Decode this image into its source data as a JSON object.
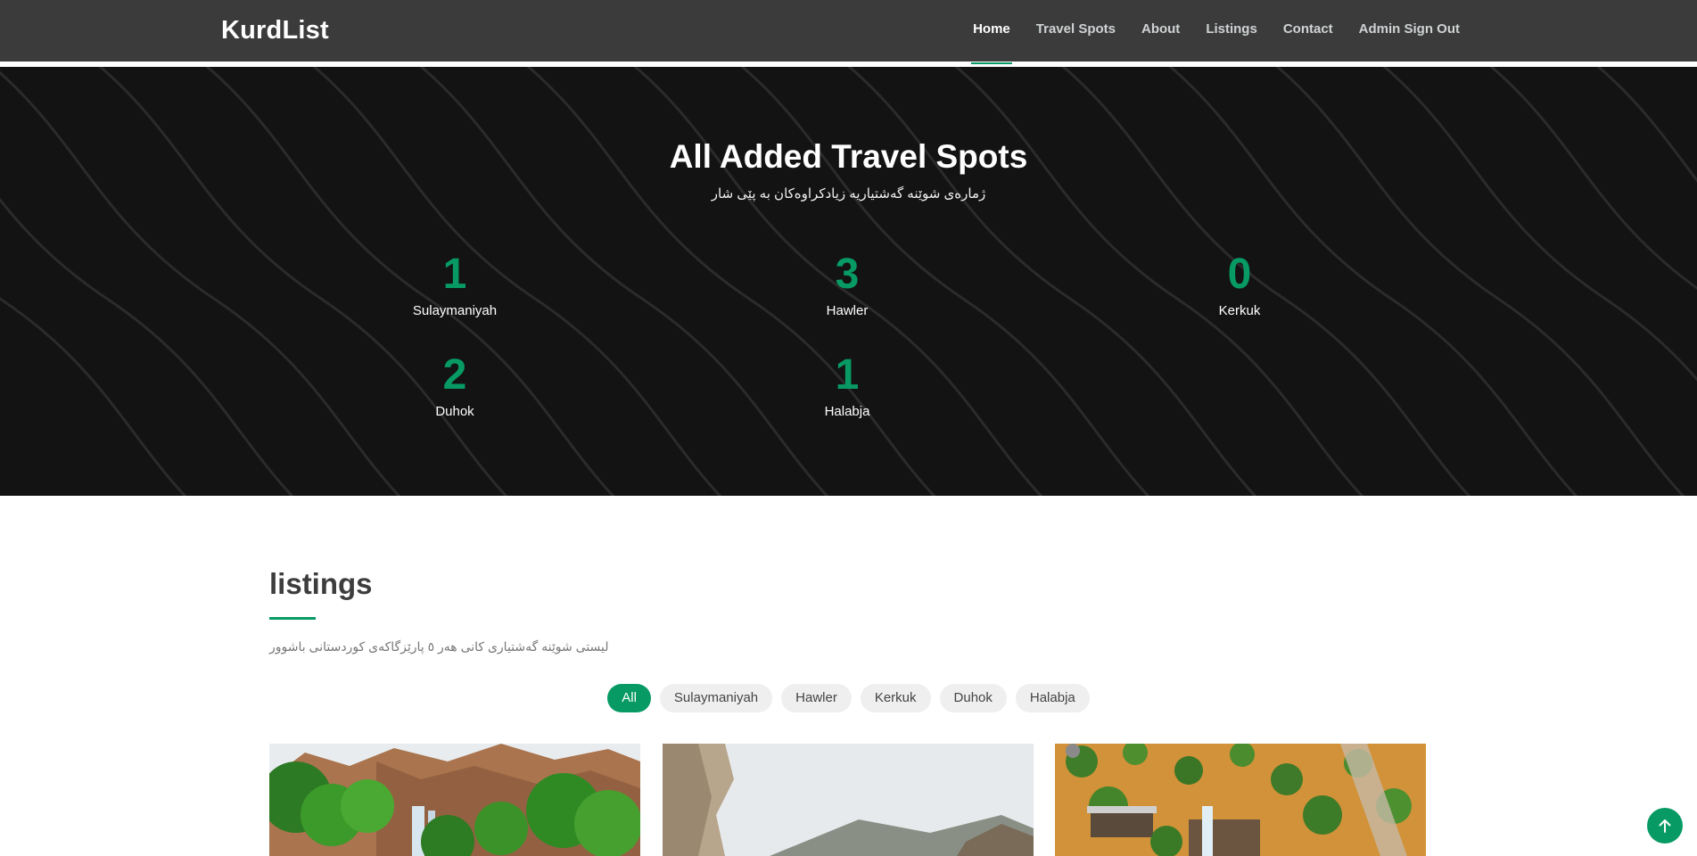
{
  "header": {
    "brand": "KurdList",
    "nav": [
      {
        "label": "Home",
        "active": true
      },
      {
        "label": "Travel Spots"
      },
      {
        "label": "About"
      },
      {
        "label": "Listings"
      },
      {
        "label": "Contact"
      },
      {
        "label": "Admin Sign Out"
      }
    ]
  },
  "hero": {
    "title": "All Added Travel Spots",
    "subtitle": "ژمارەی شوێنە گەشتیاریە زیادکراوەکان بە پێی شار",
    "stats": [
      {
        "value": "1",
        "label": "Sulaymaniyah"
      },
      {
        "value": "3",
        "label": "Hawler"
      },
      {
        "value": "0",
        "label": "Kerkuk"
      },
      {
        "value": "2",
        "label": "Duhok"
      },
      {
        "value": "1",
        "label": "Halabja"
      }
    ]
  },
  "listings": {
    "title": "listings",
    "description": "لیستی شوێنە گەشتیاری کانی هەر ٥ پارێزگاکەی کوردستانی باشوور",
    "filters": [
      "All",
      "Sulaymaniyah",
      "Hawler",
      "Kerkuk",
      "Duhok",
      "Halabja"
    ],
    "active_filter": "All"
  },
  "colors": {
    "accent": "#079a64",
    "header_bg": "#3b3b3b",
    "hero_bg": "#131313"
  },
  "icons": {
    "back_to_top": "arrow-up-icon"
  }
}
